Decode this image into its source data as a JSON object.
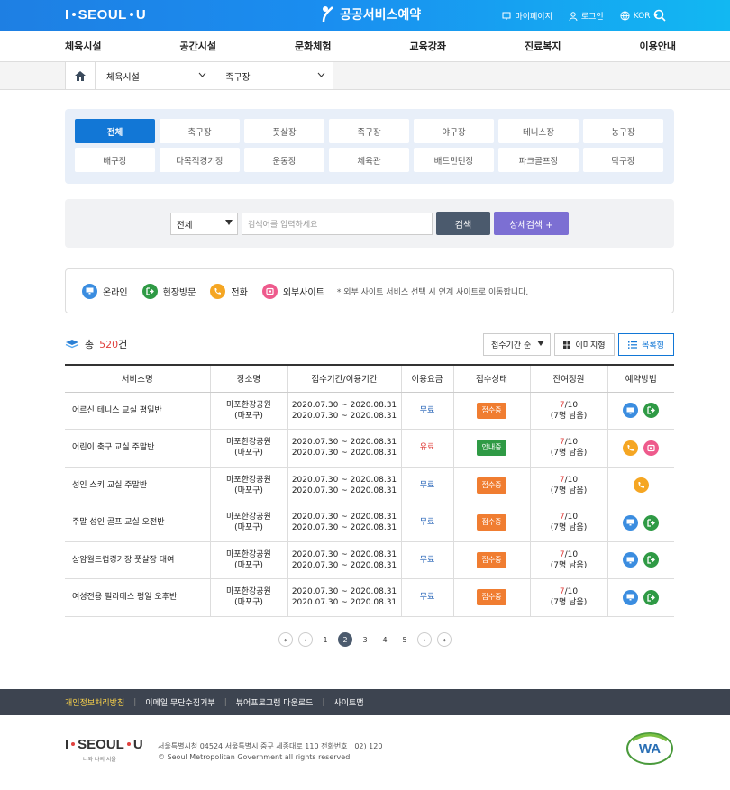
{
  "header": {
    "logo_left": "I",
    "logo_right": "SEOUL",
    "logo_end": "U",
    "brand": "공공서비스예약",
    "mypage": "마이페이지",
    "login": "로그인",
    "lang": "KOR"
  },
  "gnb": [
    "체육시설",
    "공간시설",
    "문화체험",
    "교육강좌",
    "진료복지",
    "이용안내"
  ],
  "breadcrumb": {
    "level1": "체육시설",
    "level2": "족구장"
  },
  "categories": [
    "전체",
    "축구장",
    "풋살장",
    "족구장",
    "야구장",
    "테니스장",
    "농구장",
    "배구장",
    "다목적경기장",
    "운동장",
    "체육관",
    "배드민턴장",
    "파크골프장",
    "탁구장"
  ],
  "search": {
    "select": "전체",
    "placeholder": "검색어를 입력하세요",
    "button": "검색",
    "detail_button": "상세검색 +"
  },
  "legend": {
    "online": "온라인",
    "visit": "현장방문",
    "phone": "전화",
    "external": "외부사이트",
    "note": "* 외부 사이트 서비스 선택 시 연계 사이트로 이동합니다."
  },
  "total": {
    "prefix": "총",
    "count": "520",
    "suffix": "건"
  },
  "tools": {
    "sort": "접수기간 순",
    "image": "이미지형",
    "list": "목록형"
  },
  "table": {
    "headers": [
      "서비스명",
      "장소명",
      "접수기간/이용기간",
      "이용요금",
      "접수상태",
      "잔여정원",
      "예약방법"
    ],
    "rows": [
      {
        "name": "어르신 테니스 교실 평일반",
        "place1": "마포한강공원",
        "place2": "(마포구)",
        "d1": "2020.07.30 ~ 2020.08.31",
        "d2": "2020.07.30 ~ 2020.08.31",
        "fee": "무료",
        "status": "접수중",
        "rem1": "7",
        "rem2": "/10",
        "rem3": "(7명 남음)"
      },
      {
        "name": "어린이 축구 교실 주말반",
        "place1": "마포한강공원",
        "place2": "(마포구)",
        "d1": "2020.07.30 ~ 2020.08.31",
        "d2": "2020.07.30 ~ 2020.08.31",
        "fee": "유료",
        "status": "안내중",
        "rem1": "7",
        "rem2": "/10",
        "rem3": "(7명 남음)"
      },
      {
        "name": "성인 스키 교실 주말반",
        "place1": "마포한강공원",
        "place2": "(마포구)",
        "d1": "2020.07.30 ~ 2020.08.31",
        "d2": "2020.07.30 ~ 2020.08.31",
        "fee": "무료",
        "status": "접수중",
        "rem1": "7",
        "rem2": "/10",
        "rem3": "(7명 남음)"
      },
      {
        "name": "주말 성인 골프 교실 오전반",
        "place1": "마포한강공원",
        "place2": "(마포구)",
        "d1": "2020.07.30 ~ 2020.08.31",
        "d2": "2020.07.30 ~ 2020.08.31",
        "fee": "무료",
        "status": "접수중",
        "rem1": "7",
        "rem2": "/10",
        "rem3": "(7명 남음)"
      },
      {
        "name": "상암월드컵경기장 풋살장 대여",
        "place1": "마포한강공원",
        "place2": "(마포구)",
        "d1": "2020.07.30 ~ 2020.08.31",
        "d2": "2020.07.30 ~ 2020.08.31",
        "fee": "무료",
        "status": "접수중",
        "rem1": "7",
        "rem2": "/10",
        "rem3": "(7명 남음)"
      },
      {
        "name": "여성전용 필라테스 평일 오후반",
        "place1": "마포한강공원",
        "place2": "(마포구)",
        "d1": "2020.07.30 ~ 2020.08.31",
        "d2": "2020.07.30 ~ 2020.08.31",
        "fee": "무료",
        "status": "접수중",
        "rem1": "7",
        "rem2": "/10",
        "rem3": "(7명 남음)"
      }
    ]
  },
  "pager": {
    "pages": [
      "1",
      "2",
      "3",
      "4",
      "5"
    ],
    "current": "2"
  },
  "footer": {
    "links": [
      "개인정보처리방침",
      "이메일 무단수집거부",
      "뷰어프로그램 다운로드",
      "사이트맵"
    ],
    "logo_sub": "너와 나의 서울",
    "address": "서울특별시청 04524 서울특별시 중구 세종대로 110 전화번호 : 02) 120",
    "copyright": "© Seoul Metropolitan Government all rights reserved."
  },
  "colors": {
    "primary": "#1277d6",
    "online": "#3b8de0",
    "visit": "#2f9a45",
    "phone": "#f5a623",
    "external": "#ee5a8c"
  }
}
